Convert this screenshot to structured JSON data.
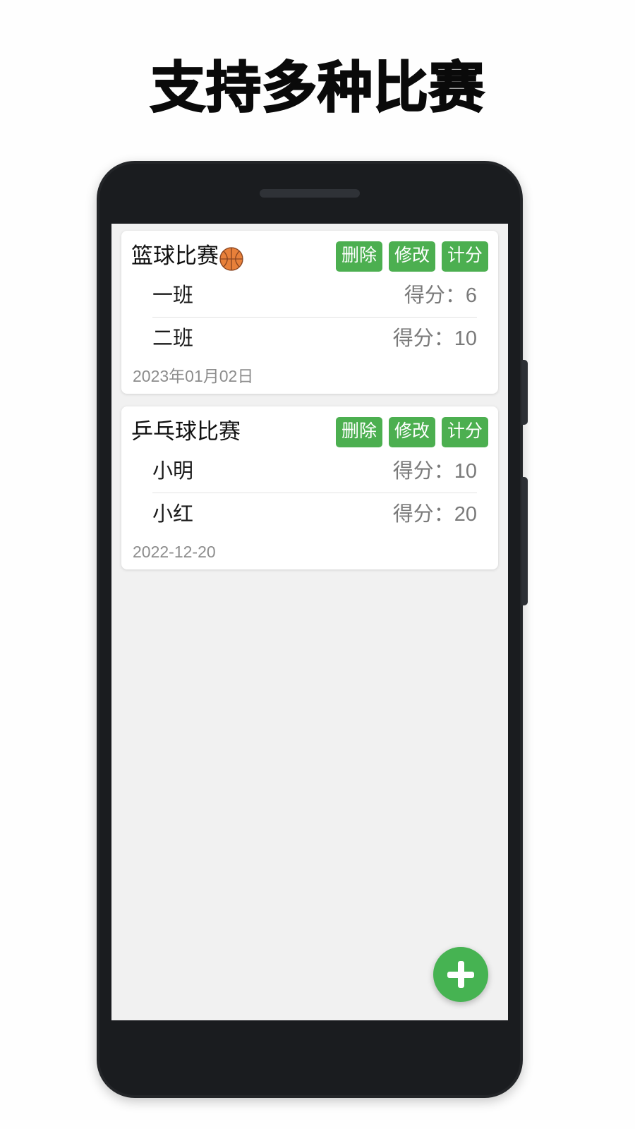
{
  "headline": "支持多种比赛",
  "theme": {
    "accent_green": "#4CAF50",
    "fab_green": "#46B352",
    "page_background": "#FEFEFE",
    "screen_background": "#F1F1F1",
    "card_background": "#FFFFFF",
    "phone_frame": "#232528",
    "score_text": "#7A7A7A",
    "date_text": "#8D8D8D"
  },
  "screen": {
    "cards": [
      {
        "title": "篮球比赛",
        "title_emoji": "basketball-emoji",
        "actions": [
          {
            "label": "删除",
            "name": "delete-button"
          },
          {
            "label": "修改",
            "name": "edit-button"
          },
          {
            "label": "计分",
            "name": "score-button"
          }
        ],
        "rows": [
          {
            "name": "一班",
            "score": "得分：6"
          },
          {
            "name": "二班",
            "score": "得分：10"
          }
        ],
        "date": "2023年01月02日"
      },
      {
        "title": "乒乓球比赛",
        "title_emoji": "",
        "actions": [
          {
            "label": "删除",
            "name": "delete-button"
          },
          {
            "label": "修改",
            "name": "edit-button"
          },
          {
            "label": "计分",
            "name": "score-button"
          }
        ],
        "rows": [
          {
            "name": "小明",
            "score": "得分：10"
          },
          {
            "name": "小红",
            "score": "得分：20"
          }
        ],
        "date": "2022-12-20"
      }
    ],
    "fab": {
      "icon": "plus-icon",
      "name": "add-match-fab"
    }
  }
}
